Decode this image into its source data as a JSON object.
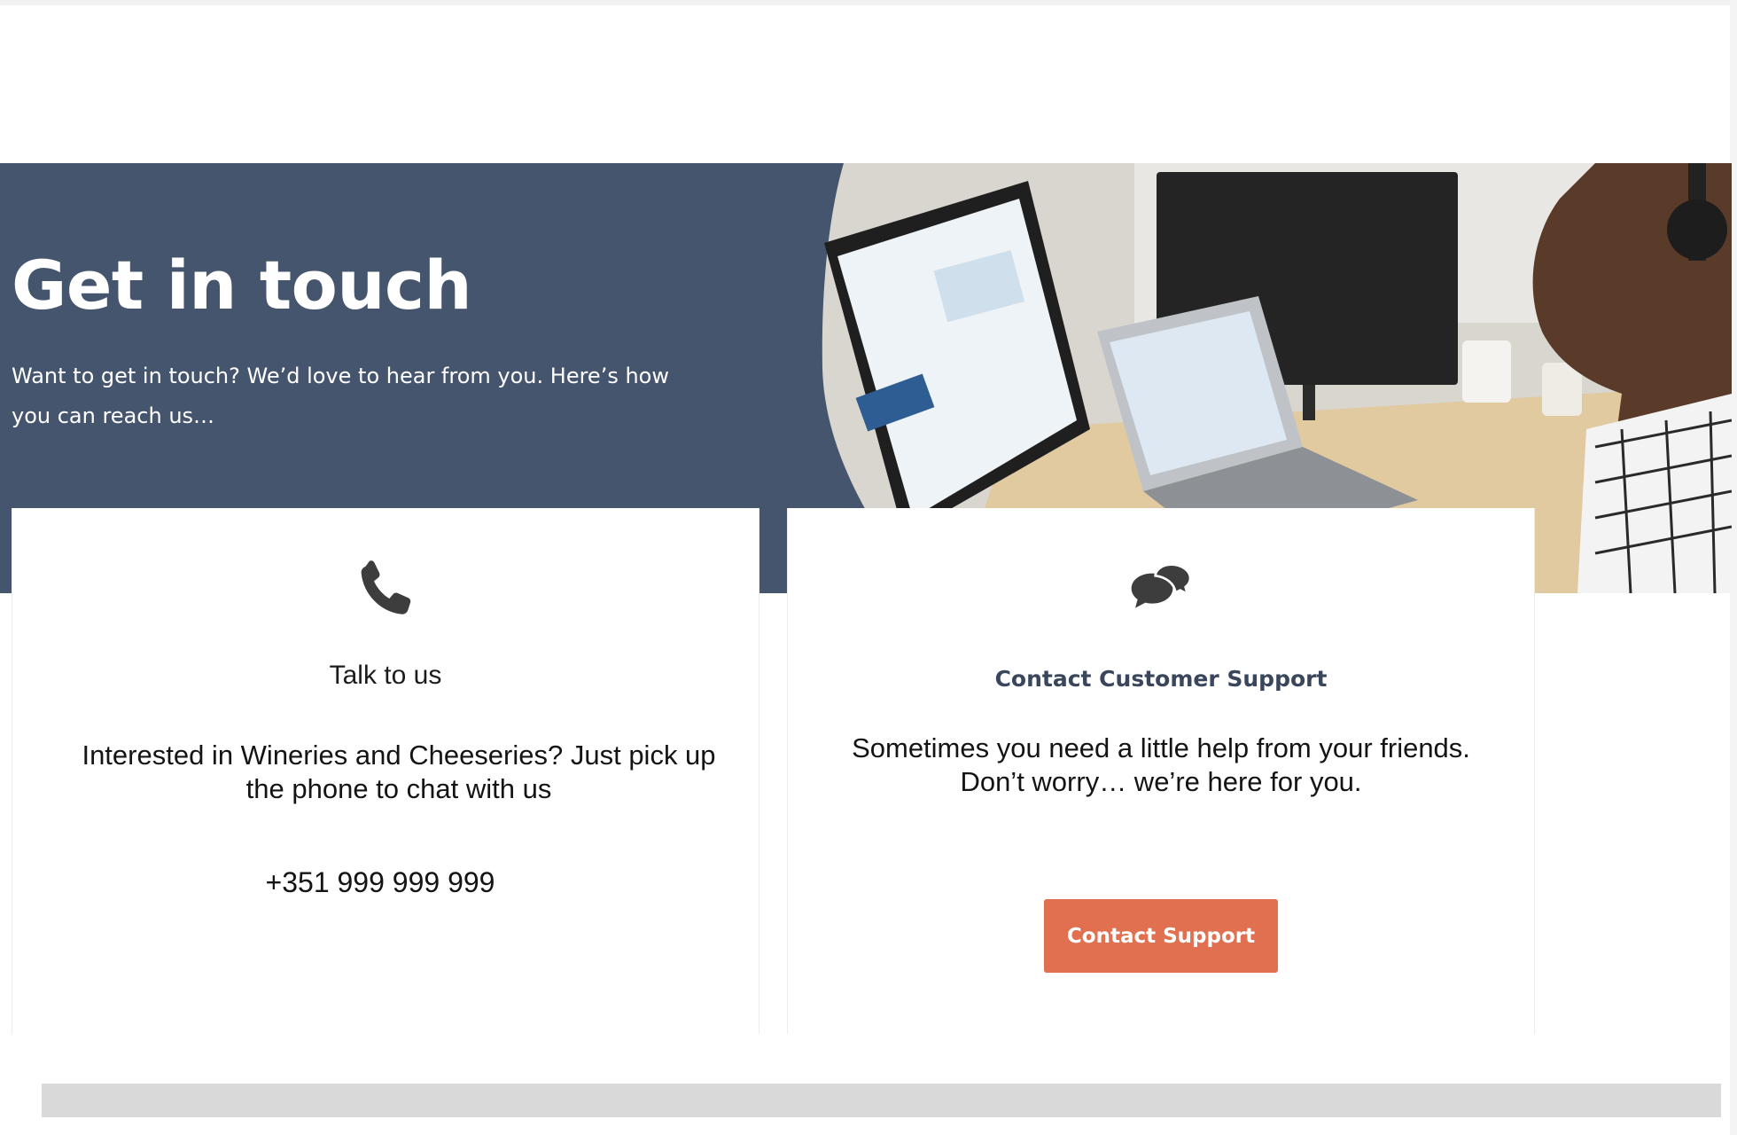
{
  "hero": {
    "title": "Get in touch",
    "subtitle": "Want to get in touch? We’d love to hear from you. Here’s how you can reach us…",
    "background_color": "#46556e",
    "accent_color": "#e0704f"
  },
  "cards": {
    "talk": {
      "icon": "phone-icon",
      "heading": "Talk to us",
      "text": "Interested in Wineries and Cheeseries? Just pick up the phone to chat with us",
      "phone": "+351 999 999 999"
    },
    "support": {
      "icon": "chat-bubbles-icon",
      "heading": "Contact Customer Support",
      "text": "Sometimes you need a little help from your friends. Don’t worry… we’re here for you.",
      "button_label": "Contact Support"
    }
  }
}
